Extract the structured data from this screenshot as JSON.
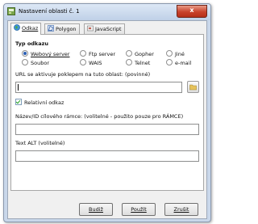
{
  "window": {
    "title": "Nastavení oblasti č. 1",
    "close_glyph": "x"
  },
  "tabs": [
    {
      "label": "Odkaz",
      "active": true,
      "icon": "globe-icon"
    },
    {
      "label": "Polygon",
      "active": false,
      "icon": "polygon-icon"
    },
    {
      "label": "JavaScript",
      "active": false,
      "icon": "javascript-icon"
    }
  ],
  "link_type": {
    "heading": "Typ odkazu",
    "options": [
      {
        "label": "Webový server",
        "selected": true
      },
      {
        "label": "Ftp server",
        "selected": false
      },
      {
        "label": "Gopher",
        "selected": false
      },
      {
        "label": "Jiné",
        "selected": false
      },
      {
        "label": "Soubor",
        "selected": false
      },
      {
        "label": "WAIS",
        "selected": false
      },
      {
        "label": "Telnet",
        "selected": false
      },
      {
        "label": "e-mail",
        "selected": false
      }
    ]
  },
  "url": {
    "label": "URL se aktivuje poklepem na tuto oblast: (povinné)",
    "value": "",
    "browse_icon": "folder-icon"
  },
  "relative": {
    "label": "Relativní odkaz",
    "checked": true
  },
  "target_frame": {
    "label": "Název/ID cílového rámce: (volitelné - použito pouze pro RÁMCE)",
    "value": ""
  },
  "alt_text": {
    "label": "Text ALT (volitelné)",
    "value": ""
  },
  "buttons": {
    "ok": "Budiž",
    "apply": "Použít",
    "cancel": "Zrušit"
  },
  "colors": {
    "title_bar": "#c9d7ea",
    "close_button": "#c8412b",
    "radio_selected": "#2b5fb4",
    "checkmark": "#21a121"
  }
}
